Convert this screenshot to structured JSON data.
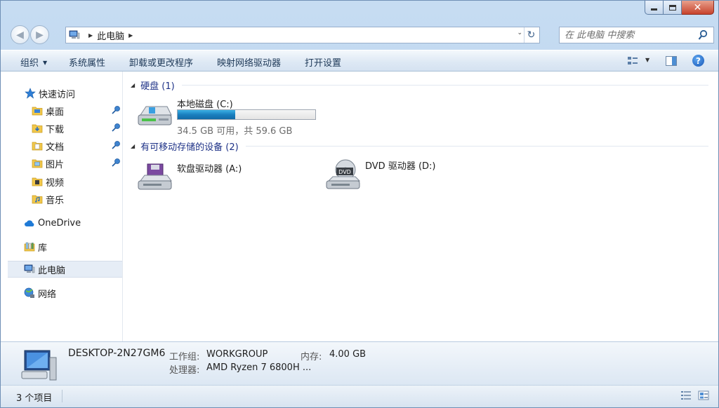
{
  "address": {
    "crumbs": [
      "此电脑"
    ]
  },
  "search": {
    "placeholder": "在 此电脑 中搜索"
  },
  "toolbar": {
    "organize": "组织",
    "system_properties": "系统属性",
    "uninstall": "卸载或更改程序",
    "map_drive": "映射网络驱动器",
    "open_settings": "打开设置"
  },
  "sidebar": {
    "quick_access": "快速访问",
    "items": [
      {
        "label": "桌面",
        "pinned": true
      },
      {
        "label": "下载",
        "pinned": true
      },
      {
        "label": "文档",
        "pinned": true
      },
      {
        "label": "图片",
        "pinned": true
      },
      {
        "label": "视频",
        "pinned": false
      },
      {
        "label": "音乐",
        "pinned": false
      }
    ],
    "onedrive": "OneDrive",
    "libraries": "库",
    "this_pc": "此电脑",
    "network": "网络"
  },
  "groups": {
    "hard_disks": {
      "title": "硬盘 (1)"
    },
    "removable": {
      "title": "有可移动存储的设备 (2)"
    }
  },
  "drives": {
    "c": {
      "name": "本地磁盘 (C:)",
      "free_text": "34.5 GB 可用，共 59.6 GB",
      "used_fraction": 0.42
    },
    "a": {
      "name": "软盘驱动器 (A:)"
    },
    "d": {
      "name": "DVD 驱动器 (D:)",
      "badge": "DVD"
    }
  },
  "details": {
    "computer_name": "DESKTOP-2N27GM6",
    "workgroup_label": "工作组:",
    "workgroup_value": "WORKGROUP",
    "memory_label": "内存:",
    "memory_value": "4.00 GB",
    "processor_label": "处理器:",
    "processor_value": "AMD Ryzen 7 6800H ..."
  },
  "status": {
    "item_count": "3 个项目"
  },
  "colors": {
    "accent": "#1e3287",
    "selection": "#e6edf6",
    "bar_fill": "#1a7fbf"
  }
}
